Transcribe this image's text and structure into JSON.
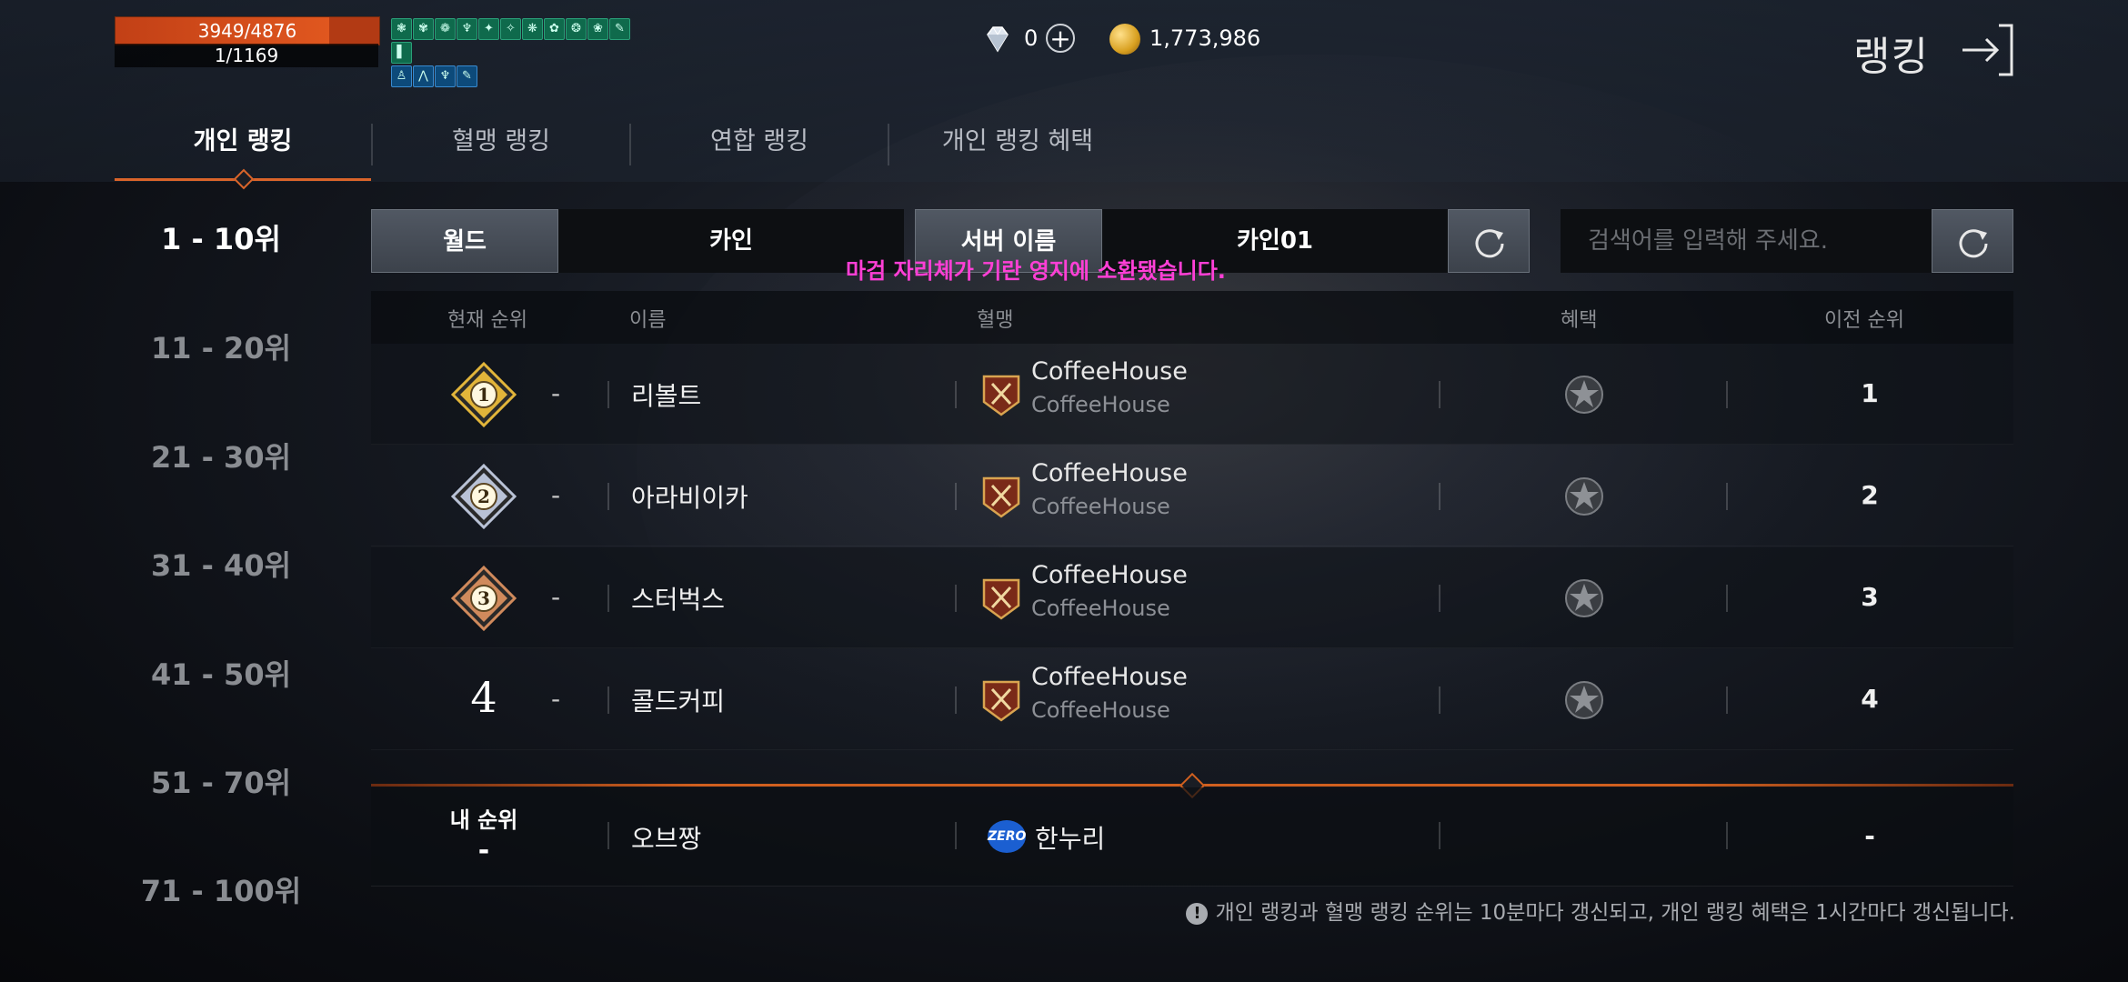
{
  "hud": {
    "hp": "3949/4876",
    "hp_fraction": 0.81,
    "sub": "1/1169",
    "buffs_row1": [
      "❃",
      "✾",
      "❁",
      "♆",
      "✦",
      "✧",
      "❋",
      "✿",
      "❂",
      "❀",
      "✎",
      "▌"
    ],
    "buffs_row2": [
      "♙",
      "⋀",
      "♆",
      "✎"
    ]
  },
  "currency": {
    "gem_count": "0",
    "gem_icon": "diamond-icon",
    "plus_icon": "plus-icon",
    "gold": "1,773,986",
    "gold_icon": "gold-coin-icon"
  },
  "title": "랭킹",
  "tabs": [
    "개인 랭킹",
    "혈맹 랭킹",
    "연합 랭킹",
    "개인 랭킹 혜택"
  ],
  "ranges": [
    "1 - 10위",
    "11 - 20위",
    "21 - 30위",
    "31 - 40위",
    "41 - 50위",
    "51 - 70위",
    "71 - 100위"
  ],
  "filters": {
    "world_label": "월드",
    "world_value": "카인",
    "server_label": "서버 이름",
    "server_value": "카인01",
    "search_placeholder": "검색어를 입력해 주세요."
  },
  "notice": "마검 자리체가 기란 영지에 소환됐습니다.",
  "table": {
    "headers": [
      "현재 순위",
      "이름",
      "혈맹",
      "혜택",
      "이전 순위"
    ],
    "rows": [
      {
        "rank": "1",
        "change": "-",
        "name": "리볼트",
        "guild": "CoffeeHouse",
        "guild_sub": "CoffeeHouse",
        "prev": "1",
        "medal_color": "#e2b53a"
      },
      {
        "rank": "2",
        "change": "-",
        "name": "아라비이카",
        "guild": "CoffeeHouse",
        "guild_sub": "CoffeeHouse",
        "prev": "2",
        "medal_color": "#b9c2d6"
      },
      {
        "rank": "3",
        "change": "-",
        "name": "스터벅스",
        "guild": "CoffeeHouse",
        "guild_sub": "CoffeeHouse",
        "prev": "3",
        "medal_color": "#d08a5c"
      },
      {
        "rank": "4",
        "change": "-",
        "name": "콜드커피",
        "guild": "CoffeeHouse",
        "guild_sub": "CoffeeHouse",
        "prev": "4"
      }
    ]
  },
  "my_rank": {
    "label": "내 순위",
    "rank": "-",
    "name": "오브짱",
    "guild_badge": "ZERO",
    "guild": "한누리",
    "prev": "-"
  },
  "footer": "개인 랭킹과 혈맹 랭킹 순위는 10분마다 갱신되고, 개인 랭킹 혜택은 1시간마다 갱신됩니다."
}
